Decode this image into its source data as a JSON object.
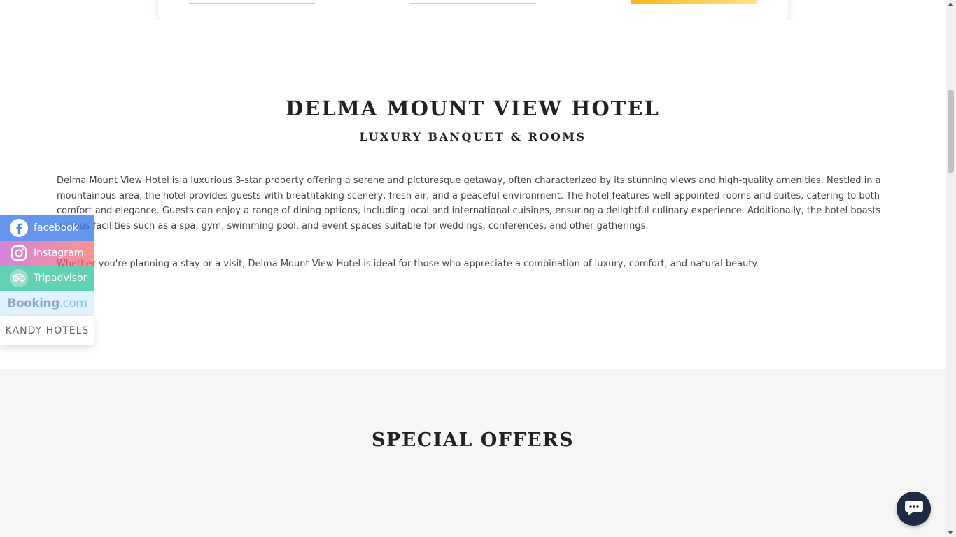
{
  "hotel": {
    "title": "DELMA MOUNT VIEW HOTEL",
    "subtitle": "LUXURY BANQUET & ROOMS",
    "paragraph1": "Delma Mount View Hotel is a luxurious 3-star property offering a serene and picturesque getaway, often characterized by its stunning views and high-quality amenities. Nestled in a mountainous area, the hotel provides guests with breathtaking scenery, fresh air, and a peaceful environment. The hotel features well-appointed rooms and suites, catering to both comfort and elegance. Guests can enjoy a range of dining options, including local and international cuisines, ensuring a delightful culinary experience. Additionally, the hotel boasts various facilities such as a spa, gym, swimming pool, and event spaces suitable for weddings, conferences, and other gatherings.",
    "paragraph2": "Whether you're planning a stay or a visit, Delma Mount View Hotel is ideal for those who appreciate a combination of luxury, comfort, and natural beauty."
  },
  "offers": {
    "title": "SPECIAL OFFERS"
  },
  "social": {
    "facebook": "facebook",
    "instagram": "Instagram",
    "tripadvisor": "Tripadvisor",
    "booking_main": "Booking",
    "booking_suffix": ".com",
    "kandy": "KANDY HOTELS"
  },
  "colors": {
    "booking_button": "#f7b81a",
    "chat_button": "#1f2a44",
    "offers_background": "#f6f6f6"
  }
}
